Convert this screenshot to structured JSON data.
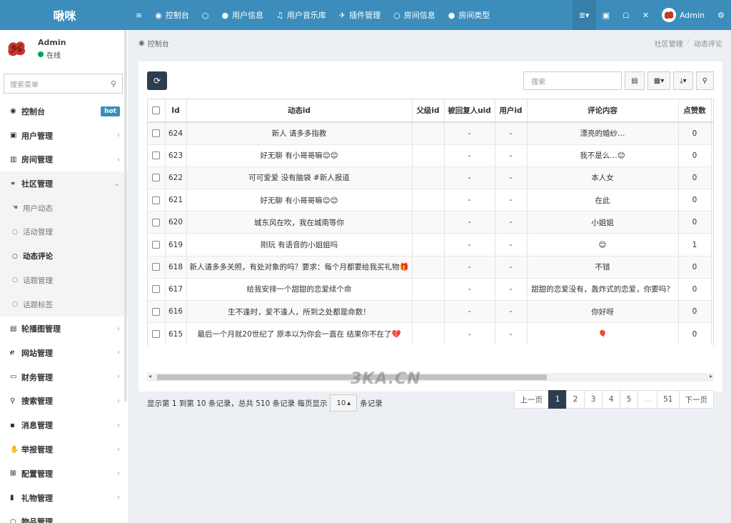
{
  "app": {
    "title": "啾咪"
  },
  "topnav": {
    "items": [
      {
        "icon": "menu-toggle-icon",
        "glyph": "≡",
        "label": ""
      },
      {
        "icon": "dashboard-icon",
        "glyph": "◉",
        "label": "控制台"
      },
      {
        "icon": "circle-icon",
        "glyph": "○",
        "label": ""
      },
      {
        "icon": "user-icon",
        "glyph": "●",
        "label": "用户信息"
      },
      {
        "icon": "music-icon",
        "glyph": "♫",
        "label": "用户音乐库"
      },
      {
        "icon": "plugin-icon",
        "glyph": "✈",
        "label": "插件管理"
      },
      {
        "icon": "circle-icon",
        "glyph": "○",
        "label": "房间信息"
      },
      {
        "icon": "dot-icon",
        "glyph": "●",
        "label": "房间类型"
      }
    ],
    "right": [
      {
        "icon": "list-icon",
        "glyph": "≣▾",
        "label": ""
      },
      {
        "icon": "trash-icon",
        "glyph": "▣",
        "label": ""
      },
      {
        "icon": "translate-icon",
        "glyph": "☖",
        "label": ""
      },
      {
        "icon": "fullscreen-icon",
        "glyph": "✕",
        "label": ""
      }
    ],
    "admin_label": "Admin",
    "settings_glyph": "⚙"
  },
  "sidebar": {
    "user_name": "Admin",
    "user_status": "在线",
    "search_placeholder": "搜索菜单",
    "items": [
      {
        "label": "控制台",
        "icon": "dashboard-icon",
        "glyph": "◉",
        "badge": "hot"
      },
      {
        "label": "用户管理",
        "icon": "user-box-icon",
        "glyph": "▣",
        "chev": "‹"
      },
      {
        "label": "房间管理",
        "icon": "bank-icon",
        "glyph": "▥",
        "chev": "‹"
      }
    ],
    "open_group": {
      "label": "社区管理",
      "icon": "binoculars-icon",
      "glyph": "⚭",
      "chev": "⌄"
    },
    "sub_items": [
      {
        "label": "用户动态",
        "glyph": "☚",
        "current": false
      },
      {
        "label": "活动管理",
        "glyph": "○",
        "current": false
      },
      {
        "label": "动态评论",
        "glyph": "○",
        "current": true
      },
      {
        "label": "话题管理",
        "glyph": "○",
        "current": false
      },
      {
        "label": "话题标签",
        "glyph": "○",
        "current": false
      }
    ],
    "items_after": [
      {
        "label": "轮播图管理",
        "icon": "image-icon",
        "glyph": "▤",
        "chev": "‹"
      },
      {
        "label": "网站管理",
        "icon": "ie-icon",
        "glyph": "ℯ",
        "chev": "‹"
      },
      {
        "label": "财务管理",
        "icon": "money-icon",
        "glyph": "▭",
        "chev": "‹"
      },
      {
        "label": "搜索管理",
        "icon": "search-icon",
        "glyph": "⚲",
        "chev": "‹"
      },
      {
        "label": "消息管理",
        "icon": "message-icon",
        "glyph": "▪",
        "chev": "‹"
      },
      {
        "label": "举报管理",
        "icon": "hand-icon",
        "glyph": "✋",
        "chev": "‹"
      },
      {
        "label": "配置管理",
        "icon": "sitemap-icon",
        "glyph": "⊞",
        "chev": "‹"
      },
      {
        "label": "礼物管理",
        "icon": "gift-icon",
        "glyph": "▮",
        "chev": "‹"
      },
      {
        "label": "物品管理",
        "icon": "circle-icon",
        "glyph": "○",
        "chev": ""
      }
    ]
  },
  "breadcrumb": {
    "left_label": "控制台",
    "left_glyph": "◉",
    "right": [
      "社区管理",
      "动态评论"
    ]
  },
  "toolbar": {
    "refresh_glyph": "⟳",
    "search_placeholder": "搜索",
    "btn1": "▤",
    "btn2": "▦▾",
    "btn3": "⤓▾",
    "btn4": "⚲"
  },
  "table": {
    "headers": [
      "Id",
      "动态id",
      "父级id",
      "被回复人uid",
      "用户id",
      "评论内容",
      "点赞数"
    ],
    "rows": [
      [
        "624",
        "新人 请多多指教",
        "",
        "-",
        "-",
        "漂亮的婚纱…",
        "0"
      ],
      [
        "623",
        "好无聊 有小哥哥嘛😊😊",
        "",
        "-",
        "-",
        "我不是么…😊",
        "0"
      ],
      [
        "622",
        "可可爱爱 没有脑袋 #新人报道",
        "",
        "-",
        "-",
        "本人女",
        "0"
      ],
      [
        "621",
        "好无聊 有小哥哥嘛😊😊",
        "",
        "-",
        "-",
        "在此",
        "0"
      ],
      [
        "620",
        "城东风在吹，我在城南等你",
        "",
        "-",
        "-",
        "小姐姐",
        "0"
      ],
      [
        "619",
        "刚玩 有语音的小姐姐吗",
        "",
        "-",
        "-",
        "😊",
        "1"
      ],
      [
        "618",
        "新人请多多关照，有处对象的吗？要求：每个月都要给我买礼物🎁",
        "",
        "-",
        "-",
        "不错",
        "0"
      ],
      [
        "617",
        "给我安排一个甜甜的恋爱续个命",
        "",
        "-",
        "-",
        "甜甜的恋爱没有，轰炸式的恋爱，你要吗？",
        "0"
      ],
      [
        "616",
        "生不逢时，爱不逢人，所到之处都是命数！",
        "",
        "-",
        "-",
        "你好呀",
        "0"
      ],
      [
        "615",
        "最后一个月就20世纪了 原本以为你会一直在 结果你不在了💔",
        "",
        "-",
        "-",
        "🎈",
        "0"
      ]
    ]
  },
  "watermark": "3KA.CN",
  "pager": {
    "info_prefix": "显示第 1 到第 10 条记录，总共 510 条记录 每页显示",
    "page_size": "10",
    "info_suffix": "条记录",
    "prev": "上一页",
    "pages": [
      "1",
      "2",
      "3",
      "4",
      "5",
      "...",
      "51"
    ],
    "next": "下一页",
    "current": "1"
  }
}
